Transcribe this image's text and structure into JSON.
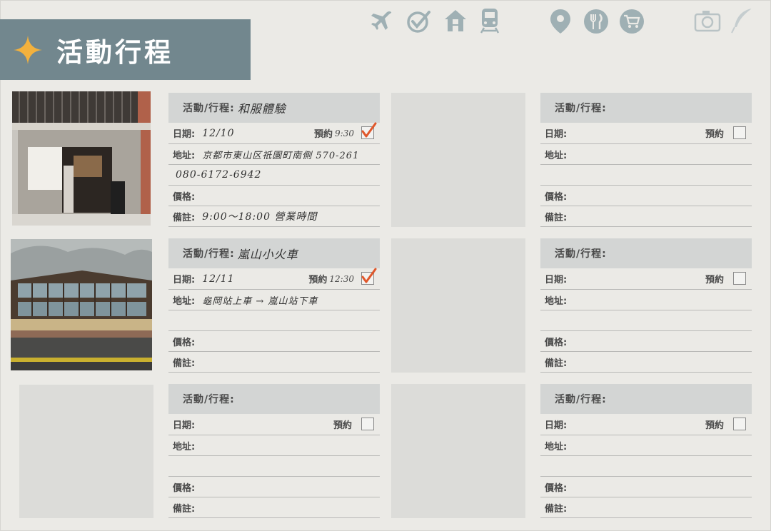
{
  "header": {
    "title": "活動行程"
  },
  "toolbar_icons": [
    "plane-icon",
    "check-circle-icon",
    "house-icon",
    "train-icon",
    "location-pin-icon",
    "restaurant-icon",
    "cart-icon",
    "camera-icon",
    "feather-pen-icon"
  ],
  "labels": {
    "activity": "活動/行程:",
    "date": "日期:",
    "reserve": "預約",
    "address": "地址:",
    "price": "價格:",
    "notes": "備註:"
  },
  "entries": [
    {
      "activity": "和服體驗",
      "date": "12/10",
      "reserve_time": "9:30",
      "reserved": true,
      "address": "京都市東山区祇園町南側 570-261",
      "address2": "080-6172-6942",
      "price": "",
      "notes": "9:00～18:00 營業時間"
    },
    {
      "activity": "嵐山小火車",
      "date": "12/11",
      "reserve_time": "12:30",
      "reserved": true,
      "address": "龜岡站上車 → 嵐山站下車",
      "address2": "",
      "price": "",
      "notes": ""
    },
    {
      "activity": "",
      "date": "",
      "reserve_time": "",
      "reserved": false,
      "address": "",
      "address2": "",
      "price": "",
      "notes": ""
    },
    {
      "activity": "",
      "date": "",
      "reserve_time": "",
      "reserved": false,
      "address": "",
      "address2": "",
      "price": "",
      "notes": ""
    },
    {
      "activity": "",
      "date": "",
      "reserve_time": "",
      "reserved": false,
      "address": "",
      "address2": "",
      "price": "",
      "notes": ""
    },
    {
      "activity": "",
      "date": "",
      "reserve_time": "",
      "reserved": false,
      "address": "",
      "address2": "",
      "price": "",
      "notes": ""
    }
  ],
  "colors": {
    "accent": "#72878e",
    "check": "#e0572b",
    "star": "#f3b13d"
  }
}
